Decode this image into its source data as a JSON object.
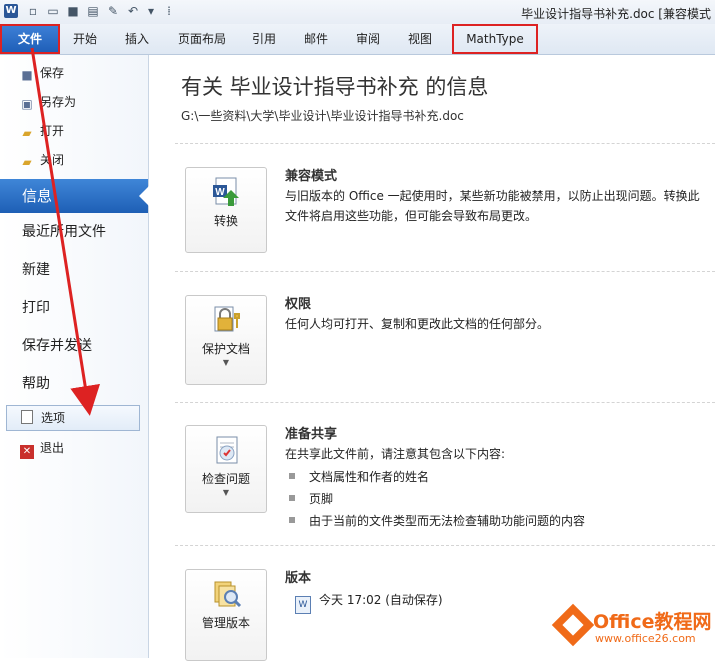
{
  "window": {
    "title": "毕业设计指导书补充.doc [兼容模式"
  },
  "tabs": [
    {
      "label": "文件"
    },
    {
      "label": "开始"
    },
    {
      "label": "插入"
    },
    {
      "label": "页面布局"
    },
    {
      "label": "引用"
    },
    {
      "label": "邮件"
    },
    {
      "label": "审阅"
    },
    {
      "label": "视图"
    },
    {
      "label": "MathType"
    }
  ],
  "nav": {
    "save": "保存",
    "save_as": "另存为",
    "open": "打开",
    "close": "关闭",
    "info": "信息",
    "recent": "最近所用文件",
    "new": "新建",
    "print": "打印",
    "save_send": "保存并发送",
    "help": "帮助",
    "options": "选项",
    "exit": "退出"
  },
  "info": {
    "title": "有关 毕业设计指导书补充 的信息",
    "path": "G:\\一些资料\\大学\\毕业设计\\毕业设计指导书补充.doc",
    "compat": {
      "title": "兼容模式",
      "desc": "与旧版本的 Office 一起使用时，某些新功能被禁用，以防止出现问题。转换此文件将启用这些功能，但可能会导致布局更改。",
      "button": "转换"
    },
    "perm": {
      "title": "权限",
      "desc": "任何人均可打开、复制和更改此文档的任何部分。",
      "button": "保护文档"
    },
    "share": {
      "title": "准备共享",
      "desc": "在共享此文件前，请注意其包含以下内容:",
      "items": [
        "文档属性和作者的姓名",
        "页脚",
        "由于当前的文件类型而无法检查辅助功能问题的内容"
      ],
      "button": "检查问题"
    },
    "versions": {
      "title": "版本",
      "entry": "今天 17:02 (自动保存)",
      "button": "管理版本"
    }
  },
  "watermark": {
    "text": "Office教程网",
    "url": "www.office26.com"
  },
  "colors": {
    "accent": "#1f5fb8",
    "highlight_box": "#dd2222",
    "watermark": "#f06a18"
  }
}
